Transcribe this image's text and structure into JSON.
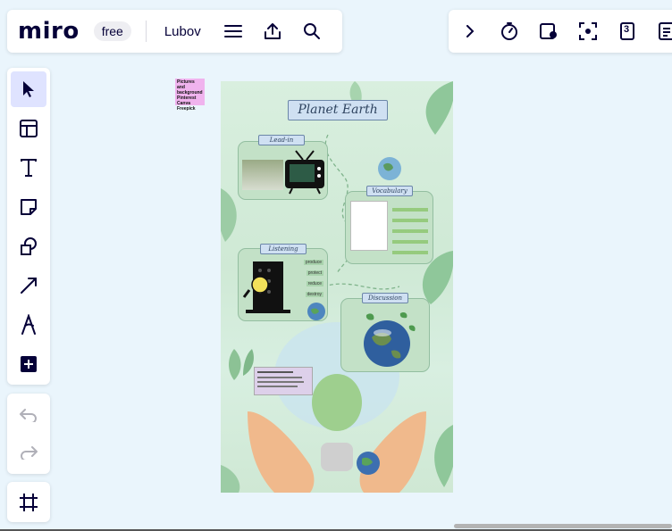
{
  "topbar": {
    "logo": "miro",
    "plan": "free",
    "board_name": "Lubov",
    "icons": [
      "menu-icon",
      "export-icon",
      "search-icon"
    ]
  },
  "right_toolbar": {
    "icons": [
      "chevron-right-icon",
      "timer-icon",
      "voting-icon",
      "focus-icon",
      "counter-icon",
      "notes-icon"
    ],
    "counter_value": "3"
  },
  "tools": [
    "select",
    "templates",
    "text",
    "sticky-note",
    "shapes",
    "connection-line",
    "pen",
    "more"
  ],
  "sticky": {
    "lines": [
      "Pictures and",
      "background",
      "Pinterest",
      "Canva",
      "Freepick"
    ]
  },
  "poster": {
    "title": "Planet Earth",
    "cards": {
      "lead_in": "Lead-in",
      "vocabulary": "Vocabulary",
      "listening": "Listening",
      "discussion": "Discussion"
    },
    "listening_words": [
      "produce",
      "protect",
      "reduce",
      "destroy"
    ]
  },
  "colors": {
    "accent": "#4262ff",
    "toolbar_active": "#dfe3ff",
    "canvas": "#eaf5fc",
    "sticky": "#f0b3ee"
  }
}
